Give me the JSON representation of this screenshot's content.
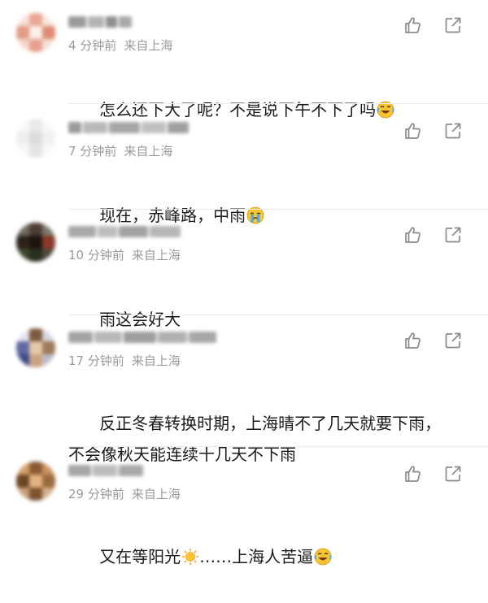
{
  "comments": [
    {
      "username": "███ ██",
      "time": "4 分钟前",
      "location": "来自上海",
      "text": "怎么还下大了呢？不是说下午不下了吗",
      "emoji": "laughing-crying-emoji"
    },
    {
      "username": "██ ██████ ███",
      "time": "7 分钟前",
      "location": "来自上海",
      "text": "现在，赤峰路，中雨",
      "emoji": "crying-emoji"
    },
    {
      "username": "█████ ████",
      "time": "10 分钟前",
      "location": "来自上海",
      "text": "雨这会好大",
      "emoji": ""
    },
    {
      "username": "██████ ██████",
      "time": "17 分钟前",
      "location": "来自上海",
      "text": "反正冬春转换时期，上海晴不了几天就要下雨，\n不会像秋天能连续十几天不下雨",
      "emoji": ""
    },
    {
      "username": "████████",
      "time": "29 分钟前",
      "location": "来自上海",
      "text": "又在等阳光",
      "sun_emoji": "sun-emoji",
      "text_after_sun": "……上海人苦逼",
      "emoji": "laughing-crying-emoji"
    }
  ],
  "colors": {
    "meta": "#9a9a9a",
    "text": "#1a1a1a",
    "icon": "#8a8a8a",
    "divider": "#ececec"
  }
}
